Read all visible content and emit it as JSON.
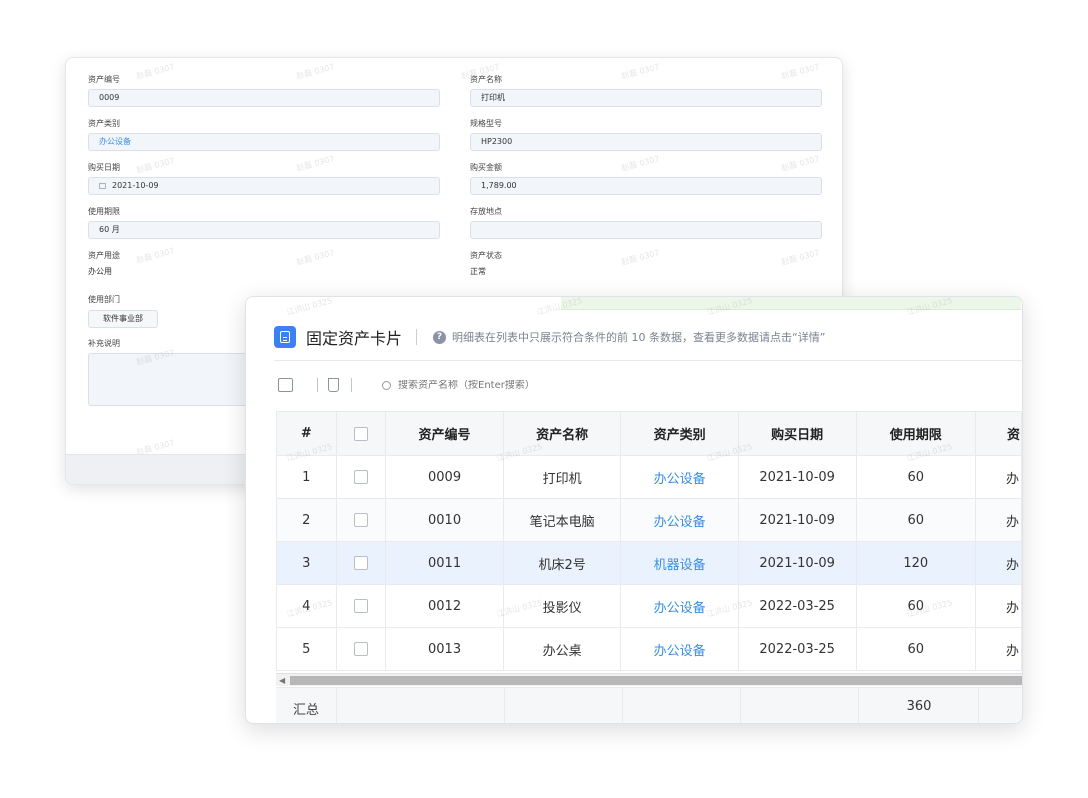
{
  "form": {
    "fields": [
      {
        "label": "资产编号",
        "value": "0009"
      },
      {
        "label": "资产名称",
        "value": "打印机"
      },
      {
        "label": "资产类别",
        "value": "办公设备"
      },
      {
        "label": "规格型号",
        "value": "HP2300"
      },
      {
        "label": "购买日期",
        "value": "2021-10-09"
      },
      {
        "label": "购买金额",
        "value": "1,789.00"
      },
      {
        "label": "使用期限",
        "value": "60 月"
      },
      {
        "label": "存放地点",
        "value": ""
      },
      {
        "label": "资产用途",
        "value": "办公用"
      },
      {
        "label": "资产状态",
        "value": "正常"
      },
      {
        "label": "使用部门",
        "value": "软件事业部"
      },
      {
        "label": "补充说明",
        "value": ""
      }
    ],
    "watermark": "赵磊 0307"
  },
  "card": {
    "title": "固定资产卡片",
    "note": "明细表在列表中只展示符合条件的前 10 条数据，查看更多数据请点击“详情”",
    "search_placeholder": "搜索资产名称（按Enter搜索）",
    "watermark": "江洪山 0325",
    "columns": [
      "#",
      "",
      "资产编号",
      "资产名称",
      "资产类别",
      "购买日期",
      "使用期限",
      "资"
    ],
    "rows": [
      {
        "n": "1",
        "code": "0009",
        "name": "打印机",
        "cat": "办公设备",
        "date": "2021-10-09",
        "term": "60",
        "extra": "办"
      },
      {
        "n": "2",
        "code": "0010",
        "name": "笔记本电脑",
        "cat": "办公设备",
        "date": "2021-10-09",
        "term": "60",
        "extra": "办"
      },
      {
        "n": "3",
        "code": "0011",
        "name": "机床2号",
        "cat": "机器设备",
        "date": "2021-10-09",
        "term": "120",
        "extra": "办"
      },
      {
        "n": "4",
        "code": "0012",
        "name": "投影仪",
        "cat": "办公设备",
        "date": "2022-03-25",
        "term": "60",
        "extra": "办"
      },
      {
        "n": "5",
        "code": "0013",
        "name": "办公桌",
        "cat": "办公设备",
        "date": "2022-03-25",
        "term": "60",
        "extra": "办"
      }
    ],
    "summary_label": "汇总",
    "summary_value": "360",
    "scroll_arrow": "◀"
  },
  "colors": {
    "accent": "#3d7ff5",
    "link": "#3a8ee6",
    "highlight_row": "#eaf3fd"
  }
}
